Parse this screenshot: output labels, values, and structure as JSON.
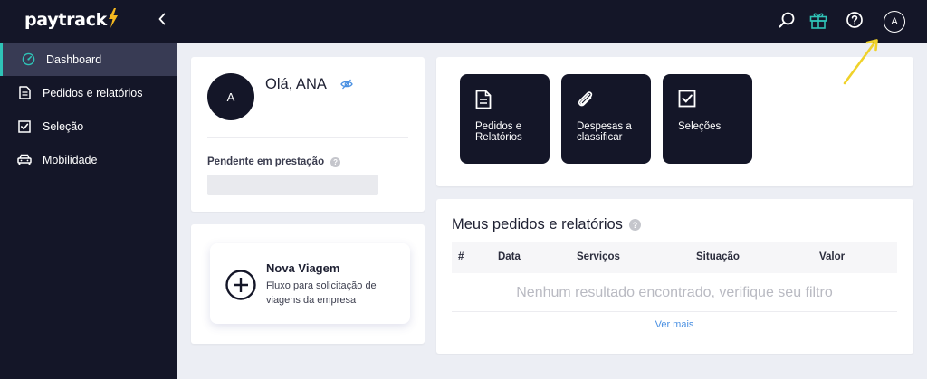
{
  "app": {
    "logo_text": "paytrack",
    "brand_colors": {
      "sidebar_bg": "#141628",
      "active_item_bg": "#383b54",
      "accent_teal": "#2fc3b7",
      "logo_bolt": "#f5b820",
      "link_blue": "#4a90e2"
    }
  },
  "topbar": {
    "icons": [
      "search-icon",
      "gift-icon",
      "help-icon"
    ],
    "avatar_initial": "A"
  },
  "sidebar": {
    "items": [
      {
        "label": "Dashboard",
        "icon": "dashboard-icon",
        "active": true
      },
      {
        "label": "Pedidos e relatórios",
        "icon": "document-icon",
        "active": false
      },
      {
        "label": "Seleção",
        "icon": "checkbox-icon",
        "active": false
      },
      {
        "label": "Mobilidade",
        "icon": "car-icon",
        "active": false
      }
    ]
  },
  "user_card": {
    "avatar_initial": "A",
    "greeting": "Olá, ANA",
    "pending_label": "Pendente em prestação"
  },
  "travel_card": {
    "title": "Nova Viagem",
    "description": "Fluxo para solicitação de viagens da empresa"
  },
  "shortcuts": [
    {
      "label": "Pedidos e Relatórios",
      "icon": "document-icon"
    },
    {
      "label": "Despesas a classificar",
      "icon": "paperclip-icon"
    },
    {
      "label": "Seleções",
      "icon": "checkbox-icon"
    }
  ],
  "orders": {
    "title": "Meus pedidos e relatórios",
    "columns": [
      "#",
      "Data",
      "Serviços",
      "Situação",
      "Valor"
    ],
    "empty_message": "Nenhum resultado encontrado, verifique seu filtro",
    "see_more": "Ver mais"
  }
}
